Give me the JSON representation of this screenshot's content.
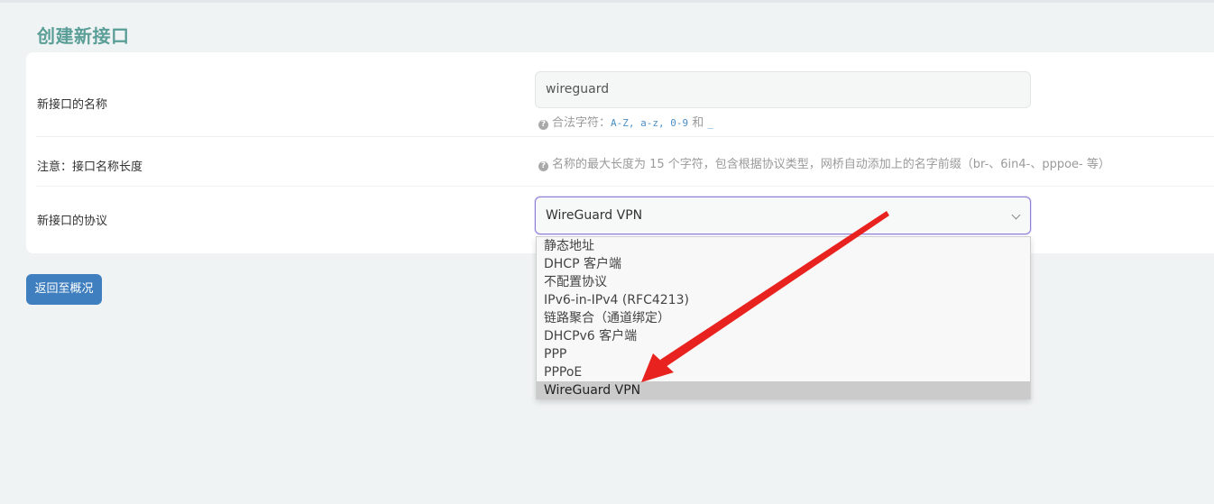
{
  "page": {
    "title": "创建新接口"
  },
  "form": {
    "name_label": "新接口的名称",
    "name_value": "wireguard",
    "name_hint_prefix": "合法字符：",
    "name_hint_chars": "A-Z, a-z, 0-9",
    "name_hint_and": " 和 ",
    "name_hint_underscore": "_",
    "note_label": "注意：接口名称长度",
    "note_hint": "名称的最大长度为 15 个字符，包含根据协议类型，网桥自动添加上的名字前缀（br-、6in4-、pppoe- 等）",
    "protocol_label": "新接口的协议",
    "protocol_selected": "WireGuard VPN",
    "protocol_options": [
      "静态地址",
      "DHCP 客户端",
      "不配置协议",
      "IPv6-in-IPv4 (RFC4213)",
      "链路聚合（通道绑定）",
      "DHCPv6 客户端",
      "PPP",
      "PPPoE",
      "WireGuard VPN"
    ]
  },
  "buttons": {
    "back": "返回至概况"
  },
  "colors": {
    "title": "#5a9e97",
    "button": "#3f7fbf",
    "focus_border": "#8f7ed8",
    "arrow": "#e8231f"
  },
  "icons": {
    "hint": "question-circle-icon",
    "select": "chevron-down-icon"
  }
}
